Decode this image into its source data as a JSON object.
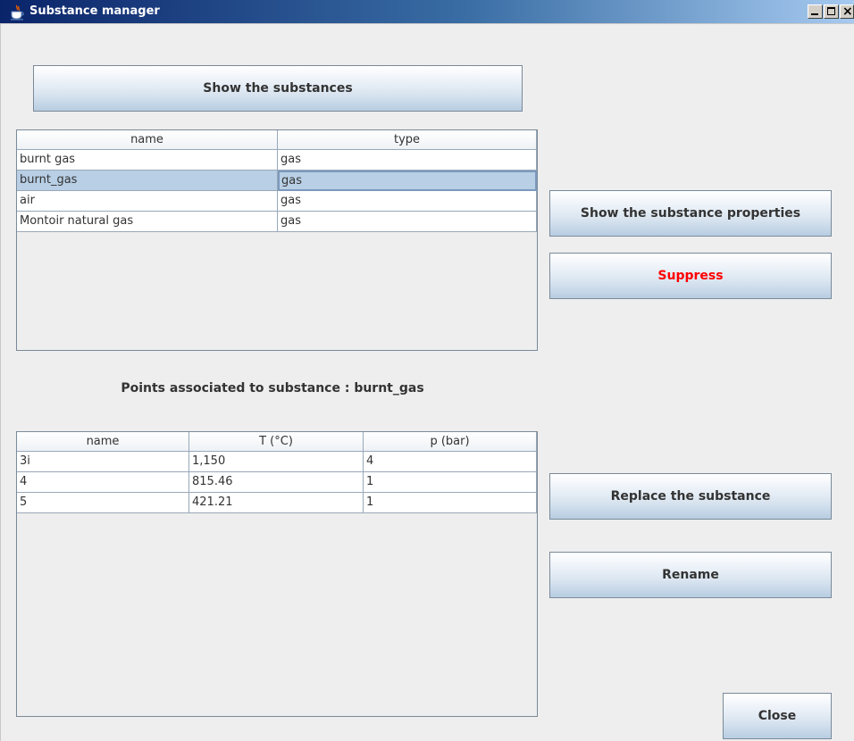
{
  "window": {
    "title": "Substance manager",
    "icon": "java-cup-icon"
  },
  "buttons": {
    "show_substances": "Show the substances",
    "show_properties": "Show the substance properties",
    "suppress": "Suppress",
    "replace": "Replace the substance",
    "rename": "Rename",
    "close": "Close"
  },
  "substances_table": {
    "columns": [
      "name",
      "type"
    ],
    "rows": [
      [
        "burnt gas",
        "gas"
      ],
      [
        "burnt_gas",
        "gas"
      ],
      [
        "air",
        "gas"
      ],
      [
        "Montoir natural gas",
        "gas"
      ]
    ],
    "selected_row": 1
  },
  "points_label": "Points associated to substance : burnt_gas",
  "points_table": {
    "columns": [
      "name",
      "T (°C)",
      "p (bar)"
    ],
    "rows": [
      [
        "3i",
        "1,150",
        "4"
      ],
      [
        "4",
        "815.46",
        "1"
      ],
      [
        "5",
        "421.21",
        "1"
      ]
    ]
  },
  "colors": {
    "title_gradient_start": "#0a246a",
    "button_top": "#ffffff",
    "button_bottom": "#b8cde2",
    "selection": "#b8cfe5",
    "suppress_text": "#ff0000"
  }
}
